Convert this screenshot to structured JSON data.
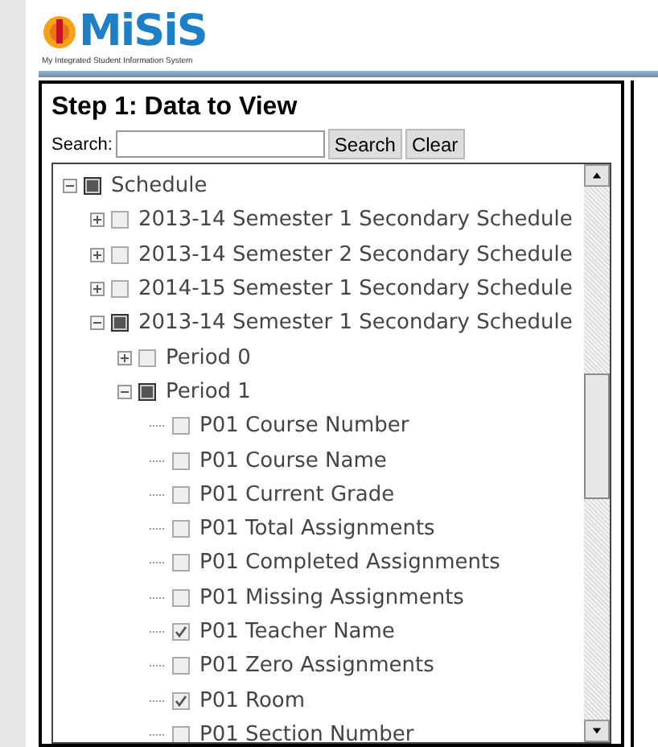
{
  "logo": {
    "name": "MiSiS",
    "tagline": "My Integrated Student Information System"
  },
  "panel": {
    "title": "Step 1: Data to View",
    "search": {
      "label": "Search:"
    },
    "buttons": [
      "Search",
      "Clear"
    ]
  },
  "tree": [
    {
      "label": "Schedule",
      "partial": true,
      "expanded": true,
      "children": [
        {
          "label": "2013-14 Semester 1 Secondary Schedule",
          "partial": false,
          "expanded": false
        },
        {
          "label": "2013-14 Semester 2 Secondary Schedule",
          "partial": false,
          "expanded": false
        },
        {
          "label": "2014-15 Semester 1 Secondary Schedule",
          "partial": false,
          "expanded": false
        },
        {
          "label": "2013-14 Semester 1 Secondary Schedule",
          "partial": true,
          "expanded": true,
          "children": [
            {
              "label": "Period 0",
              "partial": false,
              "expanded": false
            },
            {
              "label": "Period 1",
              "partial": true,
              "expanded": true,
              "children": [
                {
                  "label": "P01 Course Number",
                  "checked": false
                },
                {
                  "label": "P01 Course Name",
                  "checked": false
                },
                {
                  "label": "P01 Current Grade",
                  "checked": false
                },
                {
                  "label": "P01 Total Assignments",
                  "checked": false
                },
                {
                  "label": "P01 Completed Assignments",
                  "checked": false
                },
                {
                  "label": "P01 Missing Assignments",
                  "checked": false
                },
                {
                  "label": "P01 Teacher Name",
                  "checked": true
                },
                {
                  "label": "P01 Zero Assignments",
                  "checked": false
                },
                {
                  "label": "P01 Room",
                  "checked": true
                },
                {
                  "label": "P01 Section Number",
                  "checked": false
                }
              ]
            }
          ]
        }
      ]
    }
  ]
}
